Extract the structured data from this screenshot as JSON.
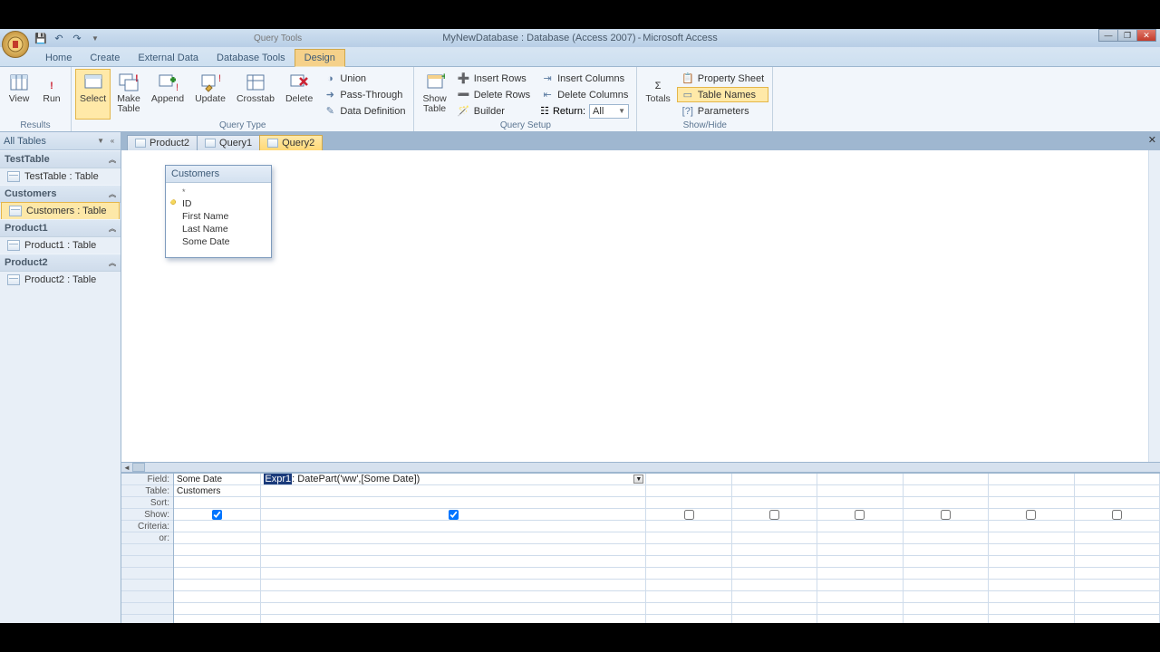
{
  "title": {
    "db": "MyNewDatabase : Database (Access 2007)",
    "app": "Microsoft Access",
    "tool_context": "Query Tools"
  },
  "tabs": {
    "home": "Home",
    "create": "Create",
    "external": "External Data",
    "dbtools": "Database Tools",
    "design": "Design"
  },
  "ribbon": {
    "results": {
      "view": "View",
      "run": "Run",
      "label": "Results"
    },
    "qtype": {
      "select": "Select",
      "make": "Make\nTable",
      "append": "Append",
      "update": "Update",
      "crosstab": "Crosstab",
      "delete": "Delete",
      "union": "Union",
      "passthrough": "Pass-Through",
      "datadef": "Data Definition",
      "label": "Query Type"
    },
    "qsetup": {
      "showtable": "Show\nTable",
      "insrow": "Insert Rows",
      "delrow": "Delete Rows",
      "builder": "Builder",
      "inscol": "Insert Columns",
      "delcol": "Delete Columns",
      "return": "Return:",
      "return_val": "All",
      "label": "Query Setup"
    },
    "showhide": {
      "totals": "Totals",
      "propsheet": "Property Sheet",
      "tablenames": "Table Names",
      "params": "Parameters",
      "label": "Show/Hide"
    }
  },
  "navpane": {
    "header": "All Tables",
    "groups": [
      {
        "name": "TestTable",
        "items": [
          "TestTable : Table"
        ]
      },
      {
        "name": "Customers",
        "items": [
          "Customers : Table"
        ],
        "selected": 0
      },
      {
        "name": "Product1",
        "items": [
          "Product1 : Table"
        ]
      },
      {
        "name": "Product2",
        "items": [
          "Product2 : Table"
        ]
      }
    ]
  },
  "doctabs": [
    {
      "label": "Product2"
    },
    {
      "label": "Query1"
    },
    {
      "label": "Query2",
      "active": true
    }
  ],
  "tablebox": {
    "title": "Customers",
    "fields": [
      {
        "n": "*",
        "star": true
      },
      {
        "n": "ID",
        "key": true
      },
      {
        "n": "First Name"
      },
      {
        "n": "Last Name"
      },
      {
        "n": "Some Date"
      }
    ]
  },
  "gridrows": [
    "Field:",
    "Table:",
    "Sort:",
    "Show:",
    "Criteria:",
    "or:"
  ],
  "gridcols": [
    {
      "field": "Some Date",
      "table": "Customers",
      "show": true
    },
    {
      "field_prefix": "Expr1",
      "field_rest": ": DatePart('ww',[Some Date])",
      "show": true,
      "active": true
    },
    {
      "show": false
    },
    {
      "show": false
    },
    {
      "show": false
    },
    {
      "show": false
    },
    {
      "show": false
    },
    {
      "show": false
    }
  ]
}
